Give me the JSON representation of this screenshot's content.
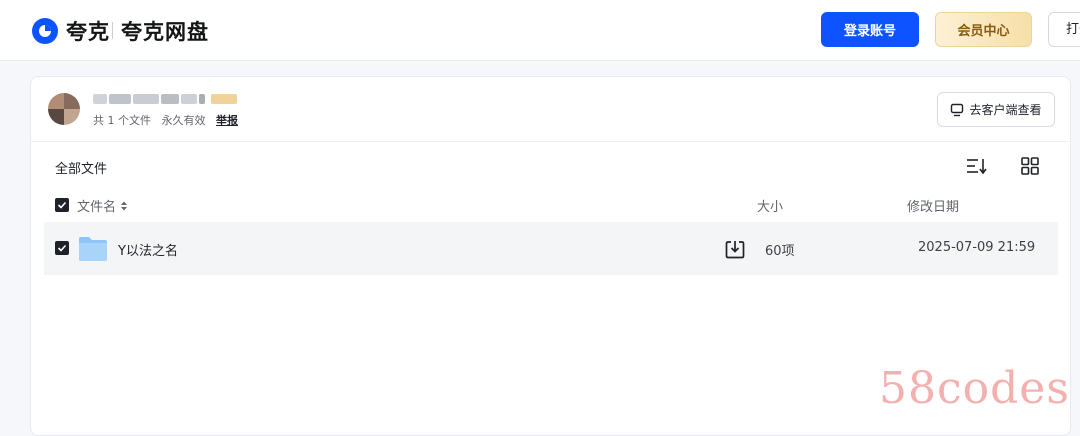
{
  "brand": {
    "logo_text": "夸克",
    "product_name": "夸克网盘",
    "accent": "#0d53ff"
  },
  "header": {
    "login_label": "登录账号",
    "vip_label": "会员中心",
    "open_label": "打开"
  },
  "share": {
    "file_count": "共 1 个文件",
    "validity": "永久有效",
    "report_label": "举报",
    "client_button_label": "去客户端查看"
  },
  "files": {
    "section_title": "全部文件",
    "columns": {
      "name": "文件名",
      "size": "大小",
      "date": "修改日期"
    },
    "rows": [
      {
        "name": "Y以法之名",
        "size": "60项",
        "date": "2025-07-09 21:59",
        "checked": true
      }
    ]
  },
  "watermark": "58codes"
}
